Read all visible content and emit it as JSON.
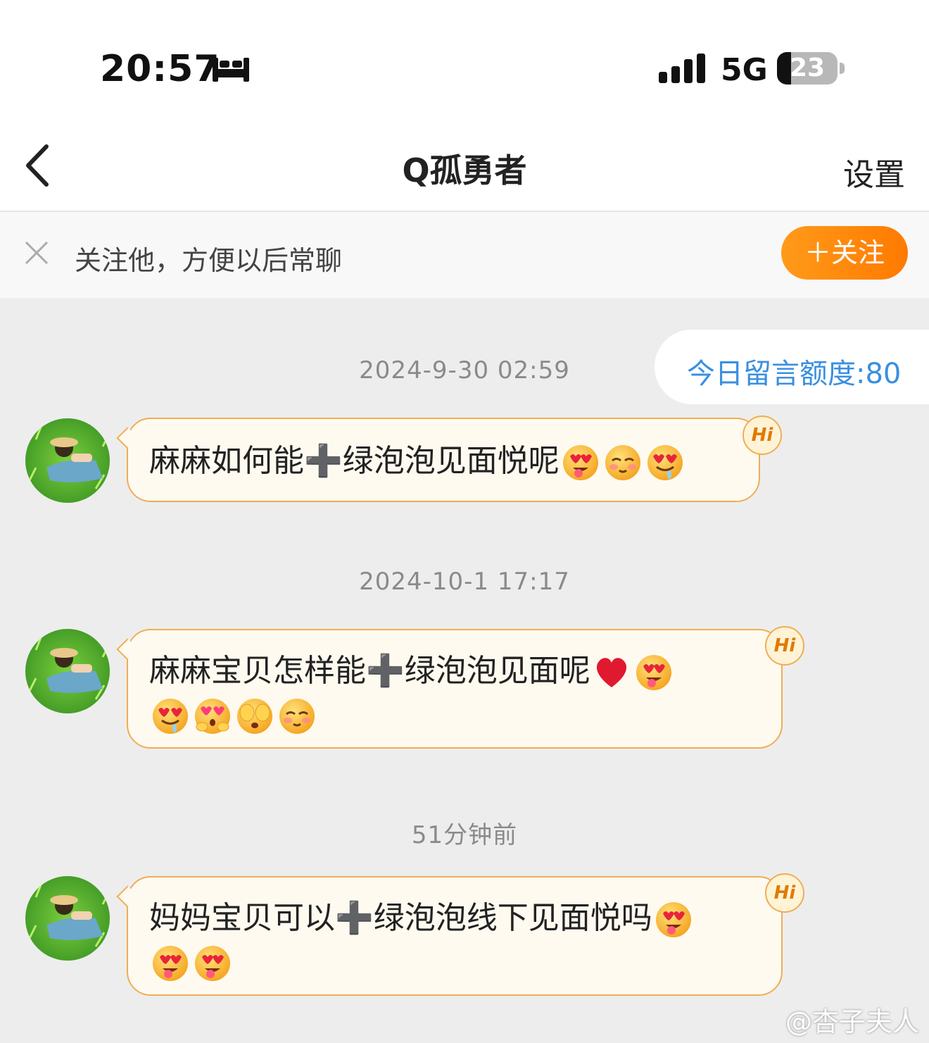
{
  "status_bar": {
    "time": "20:57",
    "network": "5G",
    "battery_level": "23",
    "battery_fraction": 0.23
  },
  "nav": {
    "title": "Q孤勇者",
    "settings_label": "设置"
  },
  "follow_bar": {
    "prompt": "关注他，方便以后常聊",
    "button_label": "＋关注"
  },
  "quota": {
    "label": "今日留言额度:80"
  },
  "messages": [
    {
      "time": "2024-9-30 02:59",
      "text_line1": "麻麻如何能",
      "plus": "➕",
      "text_line1b": "绿泡泡见面悦呢",
      "emojis": [
        "heart-eyes-tongue-emoji",
        "blush-emoji",
        "drooling-heart-eyes-emoji"
      ],
      "badge": "Hi"
    },
    {
      "time": "2024-10-1 17:17",
      "text_line1": "麻麻宝贝怎样能",
      "plus": "➕",
      "text_line1b": "绿泡泡见面呢",
      "emojis": [
        "red-heart-emoji",
        "heart-eyes-tongue-emoji",
        "drooling-heart-eyes-emoji",
        "heart-eyes-hands-emoji",
        "face-covering-eyes-emoji",
        "blush-emoji"
      ],
      "badge": "Hi"
    },
    {
      "time": "51分钟前",
      "text_line1": "妈妈宝贝可以",
      "plus": "➕",
      "text_line1b": "绿泡泡线下见面悦吗",
      "emojis": [
        "heart-eyes-tongue-emoji",
        "heart-eyes-tongue-emoji",
        "heart-eyes-tongue-emoji"
      ],
      "badge": "Hi"
    }
  ],
  "watermark": "@杏子夫人"
}
